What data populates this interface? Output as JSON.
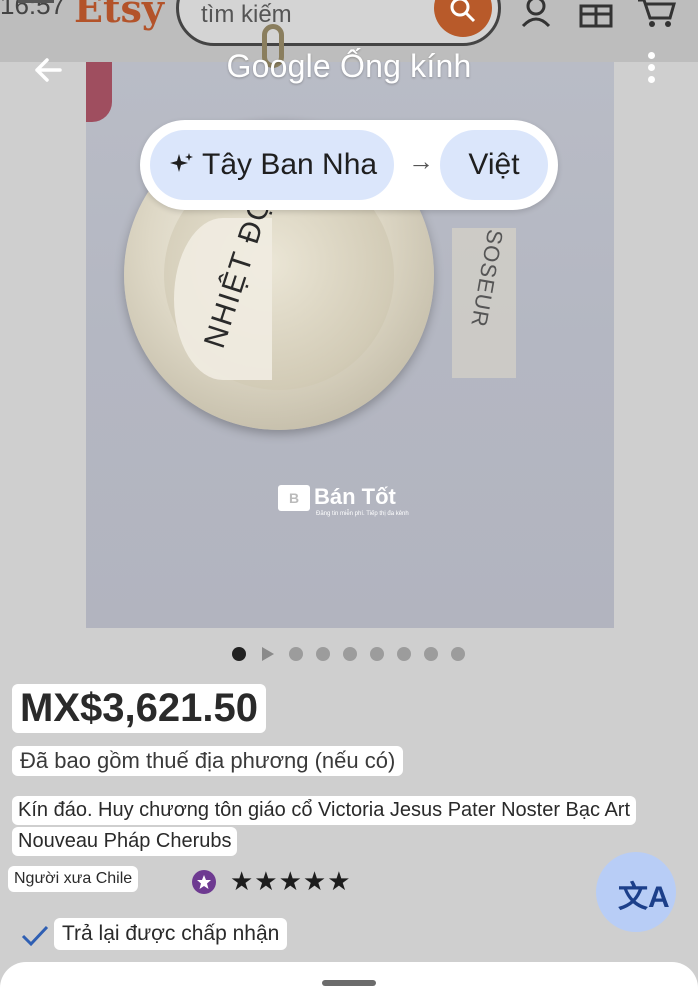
{
  "etsy": {
    "time": "16:57",
    "logo": "Etsy",
    "search_placeholder": "tìm kiếm",
    "icons": [
      "menu-icon",
      "search-icon",
      "user-icon",
      "gift-icon",
      "cart-icon"
    ]
  },
  "lens": {
    "title": "Google Ống kính",
    "icons": [
      "back-arrow-icon",
      "more-vert-icon"
    ]
  },
  "translate": {
    "source_language": "Tây Ban Nha",
    "arrow": "→",
    "target_language": "Việt"
  },
  "image_overlay": {
    "left_text": "NHIỆT ĐỘ",
    "right_text": "SOSEUR",
    "watermark": "Bán Tốt",
    "watermark_sub": "Đăng tin miễn phí. Tiếp thị đa kênh"
  },
  "pager": {
    "count": 8,
    "active_index": 0,
    "video_index": 1
  },
  "listing": {
    "price": "MX$3,621.50",
    "tax_note": "Đã bao gồm thuế địa phương (nếu có)",
    "title_lines": [
      "Kín đáo. Huy chương tôn giáo cổ Victoria Jesus Pater Noster Bạc Art",
      "Nouveau Pháp Cherubs"
    ],
    "seller": "Người xưa Chile",
    "rating_stars": 5,
    "stars_text": "★★★★★",
    "returns": "Trả lại được chấp nhận"
  },
  "fab": {
    "glyph": "文A",
    "icon": "translate-icon"
  },
  "colors": {
    "chip_bg": "#dbe6fb",
    "fab_bg": "#b8cdf6",
    "etsy_orange": "#b3532a",
    "seller_badge": "#6e3a91"
  }
}
